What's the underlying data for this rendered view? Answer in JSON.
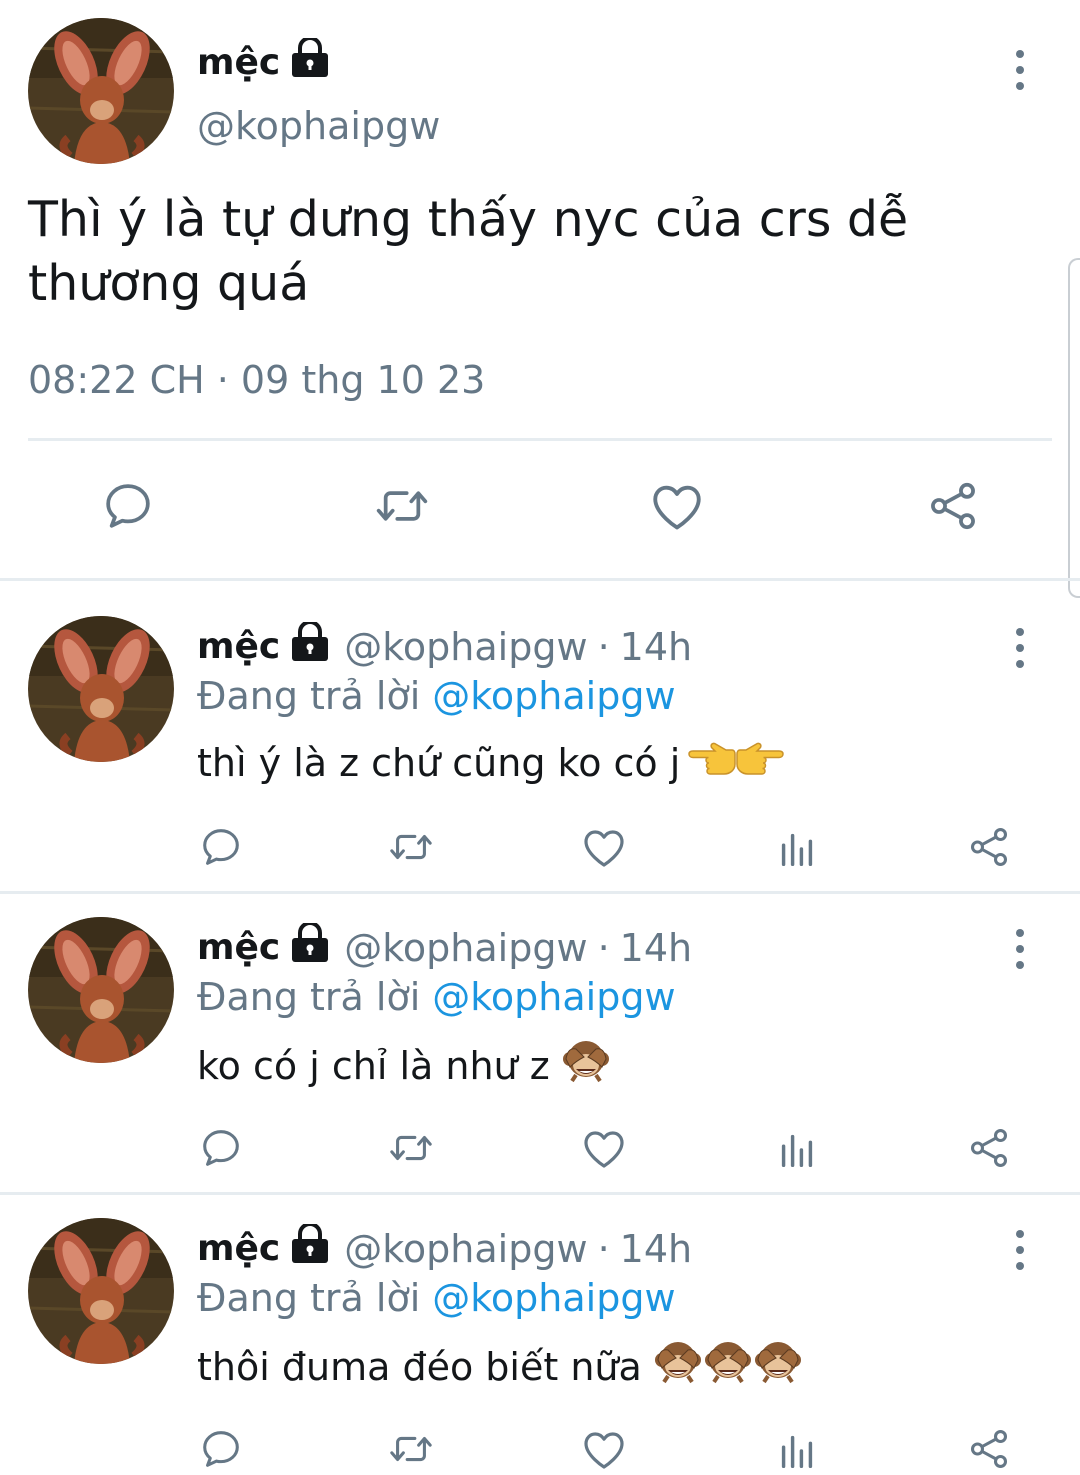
{
  "main_tweet": {
    "display_name": "mệc",
    "handle": "@kophaipgw",
    "text": "Thì ý là tự dưng thấy nyc của crs dễ thương quá",
    "timestamp": "08:22 CH · 09 thg 10 23",
    "actions": [
      "reply-icon",
      "retweet-icon",
      "like-icon",
      "share-icon"
    ]
  },
  "replies": [
    {
      "display_name": "mệc",
      "handle": "@kophaipgw",
      "separator": "·",
      "time": "14h",
      "replying_label": "Đang trả lời",
      "replying_to": "@kophaipgw",
      "text": "thì ý là z chứ cũng ko có j",
      "emoji": [
        "backhand-index-left",
        "backhand-index-right"
      ]
    },
    {
      "display_name": "mệc",
      "handle": "@kophaipgw",
      "separator": "·",
      "time": "14h",
      "replying_label": "Đang trả lời",
      "replying_to": "@kophaipgw",
      "text": "ko có j chỉ là như z",
      "emoji": [
        "see-no-evil-monkey"
      ]
    },
    {
      "display_name": "mệc",
      "handle": "@kophaipgw",
      "separator": "·",
      "time": "14h",
      "replying_label": "Đang trả lời",
      "replying_to": "@kophaipgw",
      "text": "thôi đuma đéo biết nữa",
      "emoji": [
        "see-no-evil-monkey",
        "see-no-evil-monkey",
        "see-no-evil-monkey"
      ]
    }
  ],
  "colors": {
    "text": "#14171a",
    "secondary": "#657786",
    "link": "#1b95e0",
    "divider": "#e6ecf0"
  }
}
